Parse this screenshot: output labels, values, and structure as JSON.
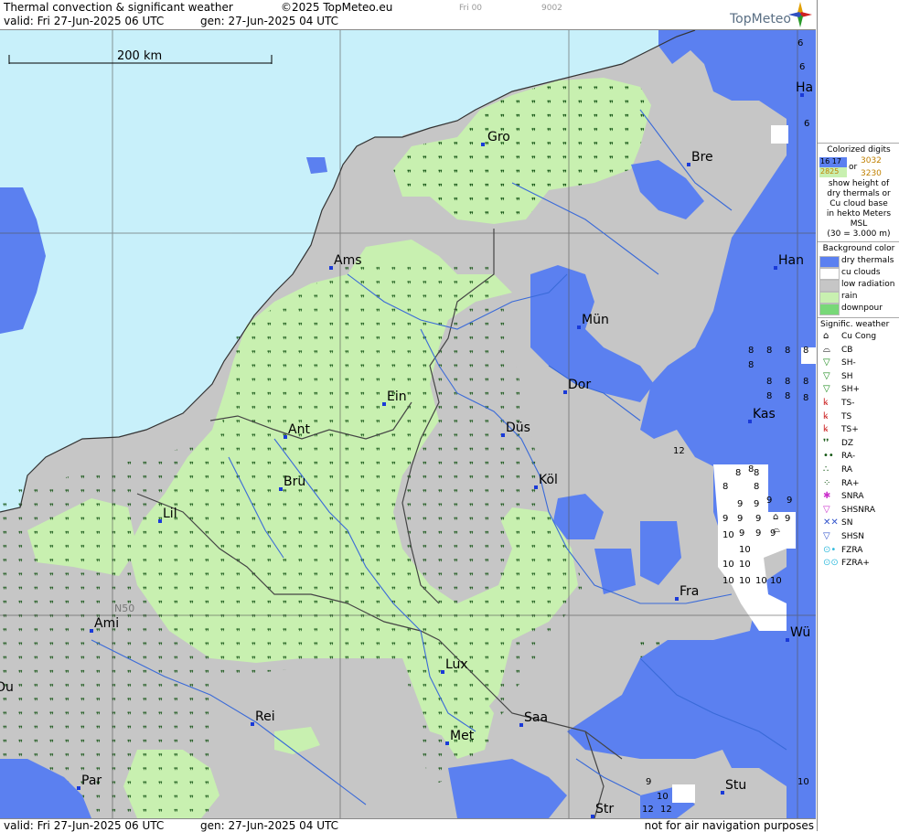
{
  "header": {
    "title": "Thermal convection & significant weather",
    "copyright": "©2025 TopMeteo.eu",
    "valid": "valid:  Fri  27-Jun-2025  06 UTC",
    "generated": "gen: 27-Jun-2025 04 UTC",
    "run_code": "Fri 00",
    "frame_code": "9002",
    "brand": "TopMeteo"
  },
  "footer": {
    "valid": "valid:  Fri  27-Jun-2025  06 UTC",
    "generated": "gen: 27-Jun-2025 04 UTC",
    "note": "not for air navigation purposes"
  },
  "map": {
    "scale_label": "200 km",
    "latitude_label": "N50",
    "colors": {
      "sea": "#c8f0fa",
      "dry": "#5b80f0",
      "low": "#c6c6c6",
      "rain": "#c8f0b0",
      "cu": "#ffffff"
    },
    "cities": [
      {
        "name": "Gro"
      },
      {
        "name": "Bre"
      },
      {
        "name": "Ha"
      },
      {
        "name": "Ams"
      },
      {
        "name": "Han"
      },
      {
        "name": "Mün"
      },
      {
        "name": "Dor"
      },
      {
        "name": "Ein"
      },
      {
        "name": "Kas"
      },
      {
        "name": "Ant"
      },
      {
        "name": "Düs"
      },
      {
        "name": "Bru"
      },
      {
        "name": "Köl"
      },
      {
        "name": "Lil"
      },
      {
        "name": "Fra"
      },
      {
        "name": "Ami"
      },
      {
        "name": "Wü"
      },
      {
        "name": "Lux"
      },
      {
        "name": "Ou"
      },
      {
        "name": "Rei"
      },
      {
        "name": "Saa"
      },
      {
        "name": "Met"
      },
      {
        "name": "Par"
      },
      {
        "name": "Stu"
      },
      {
        "name": "Str"
      }
    ],
    "thermal_digits": [
      "6",
      "6",
      "6",
      "8",
      "8",
      "8",
      "8",
      "8",
      "8",
      "8",
      "8",
      "8",
      "8",
      "8",
      "8",
      "8",
      "8",
      "8",
      "8",
      "9",
      "9",
      "9",
      "9",
      "9",
      "9",
      "9",
      "9",
      "9",
      "9",
      "9",
      "10",
      "10",
      "10",
      "10",
      "10",
      "10",
      "10",
      "10",
      "12",
      "12",
      "12",
      "10",
      "9",
      "10"
    ]
  },
  "legend": {
    "colorized_title": "Colorized digits",
    "sample_a": "16 17",
    "sample_b": "2825",
    "or": "or",
    "sample_c": "3032",
    "sample_d": "3230",
    "desc": [
      "show height of",
      "dry thermals or",
      "Cu cloud base",
      "in hekto Meters",
      "MSL",
      "(30 = 3.000 m)"
    ],
    "bg_title": "Background color",
    "bg_items": [
      {
        "label": "dry thermals",
        "color": "#5b80f0"
      },
      {
        "label": "cu clouds",
        "color": "#ffffff"
      },
      {
        "label": "low radiation",
        "color": "#c6c6c6"
      },
      {
        "label": "rain",
        "color": "#c8f0b0"
      },
      {
        "label": "downpour",
        "color": "#78d878"
      }
    ],
    "weather_title": "Signific. weather",
    "weather_items": [
      {
        "label": "Cu Cong",
        "symbol": "⌂",
        "color": "#000"
      },
      {
        "label": "CB",
        "symbol": "⌓",
        "color": "#000"
      },
      {
        "label": "SH-",
        "symbol": "▽",
        "color": "#1a8a1a"
      },
      {
        "label": "SH",
        "symbol": "▽",
        "color": "#1a8a1a"
      },
      {
        "label": "SH+",
        "symbol": "▽",
        "color": "#1a8a1a"
      },
      {
        "label": "TS-",
        "symbol": "ꝃ",
        "color": "#cc2222"
      },
      {
        "label": "TS",
        "symbol": "ꝃ",
        "color": "#cc2222"
      },
      {
        "label": "TS+",
        "symbol": "ꝃ",
        "color": "#cc2222"
      },
      {
        "label": "DZ",
        "symbol": "❜❜",
        "color": "#115511"
      },
      {
        "label": "RA-",
        "symbol": "••",
        "color": "#115511"
      },
      {
        "label": "RA",
        "symbol": "∴",
        "color": "#115511"
      },
      {
        "label": "RA+",
        "symbol": "⁘",
        "color": "#115511"
      },
      {
        "label": "SNRA",
        "symbol": "✱",
        "color": "#cc33cc"
      },
      {
        "label": "SHSNRA",
        "symbol": "▽",
        "color": "#cc33cc"
      },
      {
        "label": "SN",
        "symbol": "✕✕",
        "color": "#3355cc"
      },
      {
        "label": "SHSN",
        "symbol": "▽",
        "color": "#3355cc"
      },
      {
        "label": "FZRA",
        "symbol": "⊙•",
        "color": "#33bbdd"
      },
      {
        "label": "FZRA+",
        "symbol": "⊙⊙",
        "color": "#33bbdd"
      }
    ]
  }
}
